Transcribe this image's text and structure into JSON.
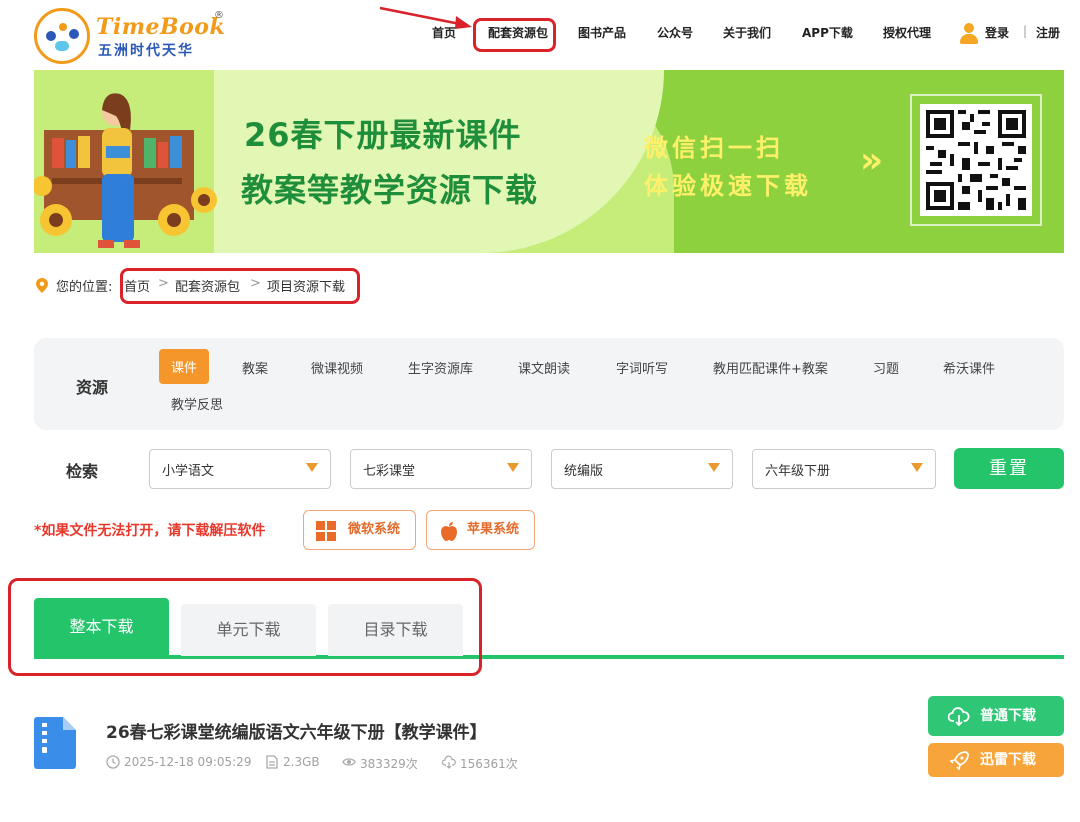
{
  "header": {
    "logo_name": "TimeBook",
    "logo_reg": "®",
    "logo_sub": "五洲时代天华",
    "nav": [
      "首页",
      "配套资源包",
      "图书产品",
      "公众号",
      "关于我们",
      "APP下载",
      "授权代理"
    ],
    "login": "登录",
    "separator": "|",
    "register": "注册"
  },
  "banner": {
    "line1": "26春下册最新课件",
    "line2": "教案等教学资源下载",
    "right1": "微信扫一扫",
    "right2": "体验极速下载",
    "chevron": "»"
  },
  "breadcrumb": {
    "prefix": "您的位置:",
    "items": [
      "首页",
      "配套资源包",
      "项目资源下载"
    ],
    "sep": ">"
  },
  "filters": {
    "resource_label": "资源",
    "tags": [
      "课件",
      "教案",
      "微课视频",
      "生字资源库",
      "课文朗读",
      "字词听写",
      "教用匹配课件+教案",
      "习题",
      "希沃课件",
      "教学反思"
    ],
    "search_label": "检索",
    "selects": [
      "小学语文",
      "七彩课堂",
      "统编版",
      "六年级下册"
    ],
    "reset": "重置"
  },
  "warn": {
    "text": "*如果文件无法打开，请下载解压软件",
    "windows": "微软系统",
    "apple": "苹果系统"
  },
  "tabs": [
    "整本下载",
    "单元下载",
    "目录下载"
  ],
  "item": {
    "title": "26春七彩课堂统编版语文六年级下册【教学课件】",
    "date": "2025-12-18 09:05:29",
    "size": "2.3GB",
    "views": "383329次",
    "downloads": "156361次",
    "normal_download": "普通下载",
    "thunder_download": "迅雷下载"
  },
  "colors": {
    "accent_green": "#23c46a",
    "accent_orange": "#f5962a",
    "annotation_red": "#d9222a",
    "warn_red": "#e8382b"
  }
}
